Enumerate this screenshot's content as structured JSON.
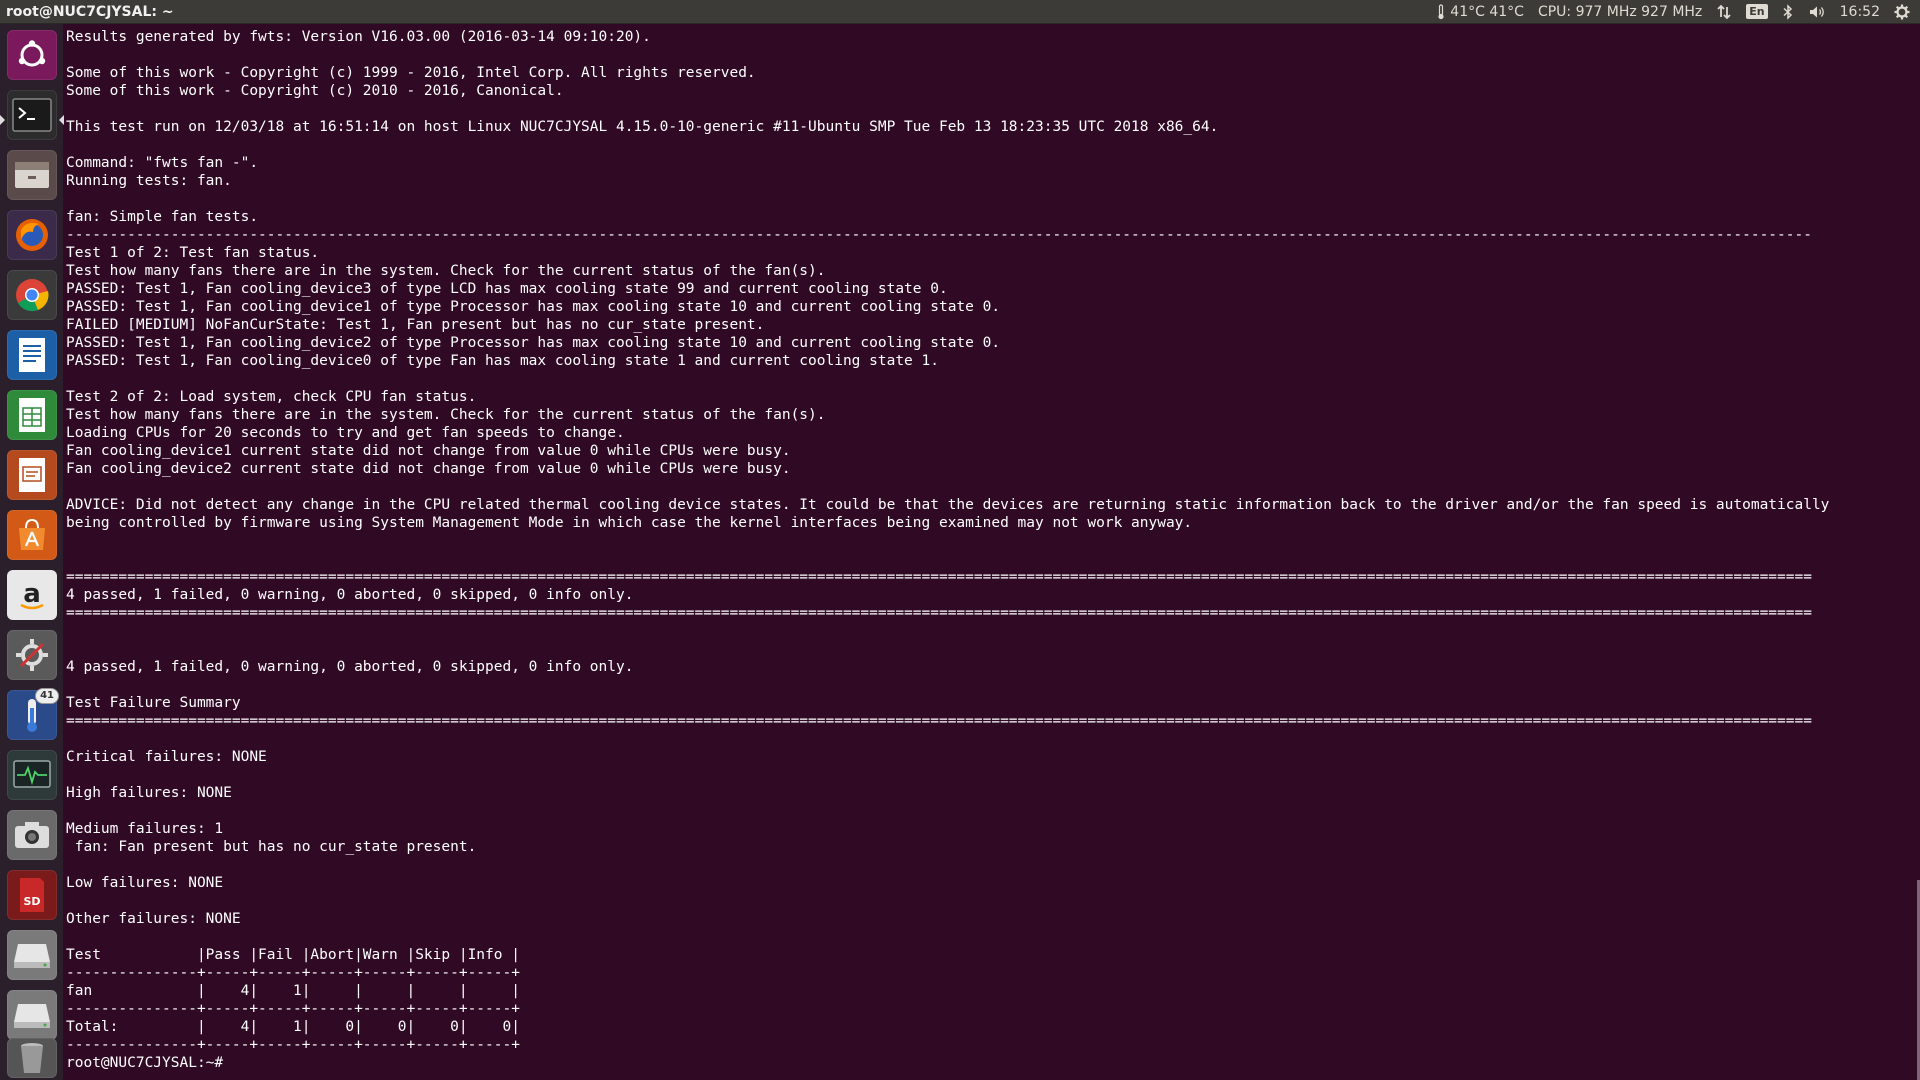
{
  "window": {
    "title": "root@NUC7CJYSAL: ~"
  },
  "indicators": {
    "temp": "41°C 41°C",
    "cpu": "CPU: 977 MHz 927 MHz",
    "lang": "En",
    "time": "16:52"
  },
  "launcher": {
    "items": [
      {
        "name": "ubuntu-dash-icon"
      },
      {
        "name": "terminal-icon"
      },
      {
        "name": "files-icon"
      },
      {
        "name": "firefox-icon"
      },
      {
        "name": "chrome-icon"
      },
      {
        "name": "writer-icon"
      },
      {
        "name": "calc-icon"
      },
      {
        "name": "impress-icon"
      },
      {
        "name": "software-center-icon"
      },
      {
        "name": "amazon-icon"
      },
      {
        "name": "system-settings-icon"
      },
      {
        "name": "sensor-indicator-icon",
        "badge": "41"
      },
      {
        "name": "system-monitor-icon"
      },
      {
        "name": "camera-icon"
      },
      {
        "name": "sd-card-icon"
      },
      {
        "name": "drive-icon"
      },
      {
        "name": "drive-icon-2"
      },
      {
        "name": "trash-icon"
      }
    ]
  },
  "terminal": {
    "lines": [
      "Results generated by fwts: Version V16.03.00 (2016-03-14 09:10:20).",
      "",
      "Some of this work - Copyright (c) 1999 - 2016, Intel Corp. All rights reserved.",
      "Some of this work - Copyright (c) 2010 - 2016, Canonical.",
      "",
      "This test run on 12/03/18 at 16:51:14 on host Linux NUC7CJYSAL 4.15.0-10-generic #11-Ubuntu SMP Tue Feb 13 18:23:35 UTC 2018 x86_64.",
      "",
      "Command: \"fwts fan -\".",
      "Running tests: fan.",
      "",
      "fan: Simple fan tests.",
      "--------------------------------------------------------------------------------------------------------------------------------------------------------------------------------------------------------",
      "Test 1 of 2: Test fan status.",
      "Test how many fans there are in the system. Check for the current status of the fan(s).",
      "PASSED: Test 1, Fan cooling_device3 of type LCD has max cooling state 99 and current cooling state 0.",
      "PASSED: Test 1, Fan cooling_device1 of type Processor has max cooling state 10 and current cooling state 0.",
      "FAILED [MEDIUM] NoFanCurState: Test 1, Fan present but has no cur_state present.",
      "PASSED: Test 1, Fan cooling_device2 of type Processor has max cooling state 10 and current cooling state 0.",
      "PASSED: Test 1, Fan cooling_device0 of type Fan has max cooling state 1 and current cooling state 1.",
      "",
      "Test 2 of 2: Load system, check CPU fan status.",
      "Test how many fans there are in the system. Check for the current status of the fan(s).",
      "Loading CPUs for 20 seconds to try and get fan speeds to change.",
      "Fan cooling_device1 current state did not change from value 0 while CPUs were busy.",
      "Fan cooling_device2 current state did not change from value 0 while CPUs were busy.",
      "",
      "ADVICE: Did not detect any change in the CPU related thermal cooling device states. It could be that the devices are returning static information back to the driver and/or the fan speed is automatically",
      "being controlled by firmware using System Management Mode in which case the kernel interfaces being examined may not work anyway.",
      "",
      "",
      "========================================================================================================================================================================================================",
      "4 passed, 1 failed, 0 warning, 0 aborted, 0 skipped, 0 info only.",
      "========================================================================================================================================================================================================",
      "",
      "",
      "4 passed, 1 failed, 0 warning, 0 aborted, 0 skipped, 0 info only.",
      "",
      "Test Failure Summary",
      "========================================================================================================================================================================================================",
      "",
      "Critical failures: NONE",
      "",
      "High failures: NONE",
      "",
      "Medium failures: 1",
      " fan: Fan present but has no cur_state present.",
      "",
      "Low failures: NONE",
      "",
      "Other failures: NONE",
      "",
      "Test           |Pass |Fail |Abort|Warn |Skip |Info |",
      "---------------+-----+-----+-----+-----+-----+-----+",
      "fan            |    4|    1|     |     |     |     |",
      "---------------+-----+-----+-----+-----+-----+-----+",
      "Total:         |    4|    1|    0|    0|    0|    0|",
      "---------------+-----+-----+-----+-----+-----+-----+",
      "root@NUC7CJYSAL:~# "
    ]
  },
  "colors": {
    "terminal_bg": "#300a24",
    "panel_bg": "#3c3b37",
    "launcher_bg": "#2b1f2c",
    "text": "#ffffff"
  }
}
